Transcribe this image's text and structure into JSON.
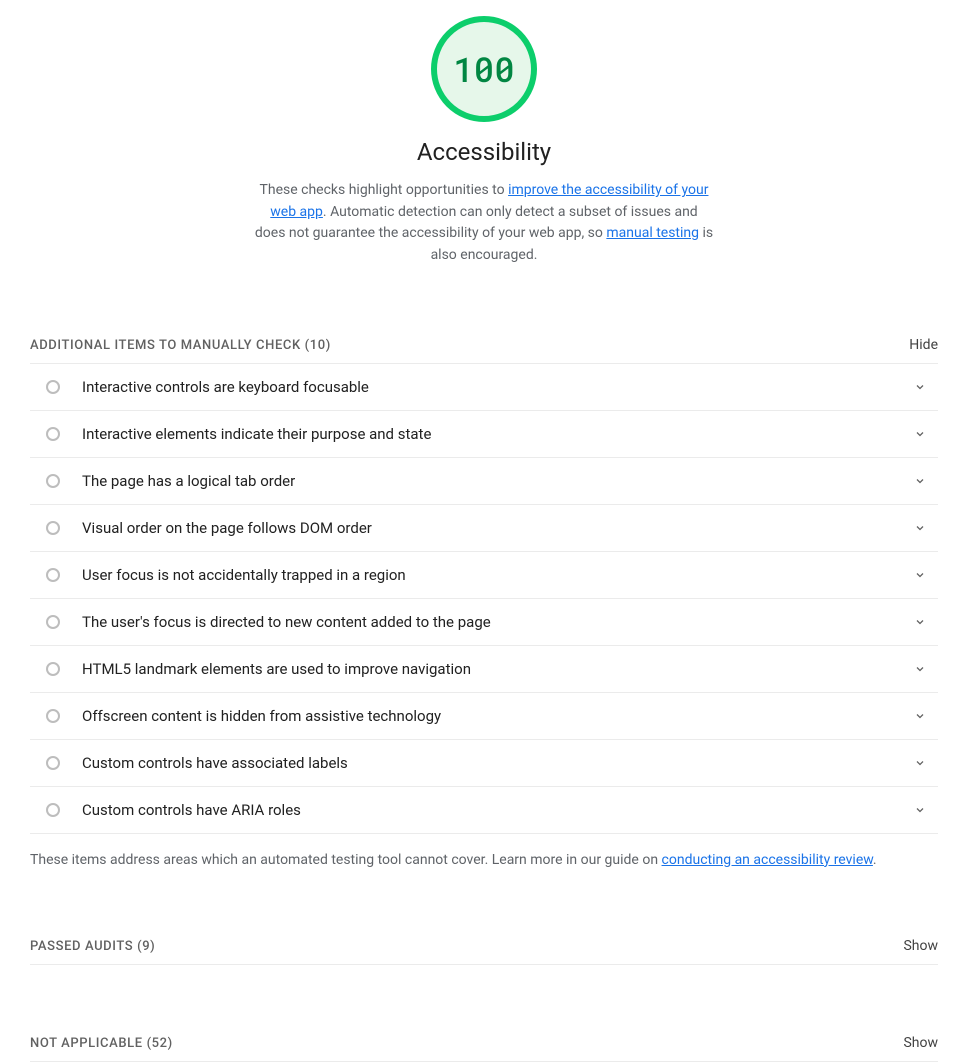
{
  "gauge": {
    "score": "100",
    "title": "Accessibility"
  },
  "description": {
    "prefix": "These checks highlight opportunities to ",
    "link1": "improve the accessibility of your web app",
    "mid": ". Automatic detection can only detect a subset of issues and does not guarantee the accessibility of your web app, so ",
    "link2": "manual testing",
    "suffix": " is also encouraged."
  },
  "sections": {
    "manual": {
      "label": "ADDITIONAL ITEMS TO MANUALLY CHECK",
      "count": "(10)",
      "toggle": "Hide",
      "items": [
        "Interactive controls are keyboard focusable",
        "Interactive elements indicate their purpose and state",
        "The page has a logical tab order",
        "Visual order on the page follows DOM order",
        "User focus is not accidentally trapped in a region",
        "The user's focus is directed to new content added to the page",
        "HTML5 landmark elements are used to improve navigation",
        "Offscreen content is hidden from assistive technology",
        "Custom controls have associated labels",
        "Custom controls have ARIA roles"
      ],
      "footer_prefix": "These items address areas which an automated testing tool cannot cover. Learn more in our guide on ",
      "footer_link": "conducting an accessibility review",
      "footer_suffix": "."
    },
    "passed": {
      "label": "PASSED AUDITS",
      "count": "(9)",
      "toggle": "Show"
    },
    "na": {
      "label": "NOT APPLICABLE",
      "count": "(52)",
      "toggle": "Show"
    }
  }
}
